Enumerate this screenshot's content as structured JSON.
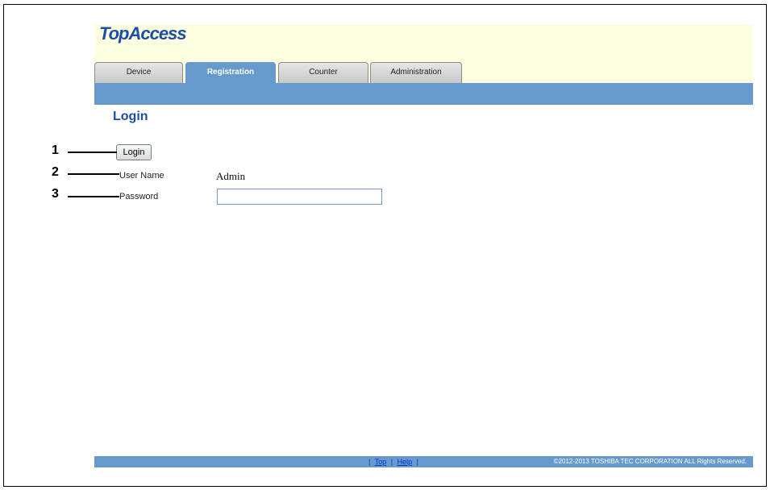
{
  "app": {
    "logo": "TopAccess"
  },
  "tabs": [
    {
      "label": "Device",
      "active": false
    },
    {
      "label": "Registration",
      "active": true
    },
    {
      "label": "Counter",
      "active": false
    },
    {
      "label": "Administration",
      "active": false
    }
  ],
  "page": {
    "title": "Login"
  },
  "form": {
    "login_button": "Login",
    "username_label": "User Name",
    "username_value": "Admin",
    "password_label": "Password",
    "password_value": ""
  },
  "footer": {
    "sep": "|",
    "top_link": "Top",
    "help_link": "Help",
    "copyright": "©2012-2013 TOSHIBA TEC CORPORATION ALL Rights Reserved."
  },
  "callouts": [
    "1",
    "2",
    "3"
  ],
  "colors": {
    "tab_active": "#6699cc",
    "header_bg": "#fdfde0",
    "title": "#1a4ea8"
  }
}
